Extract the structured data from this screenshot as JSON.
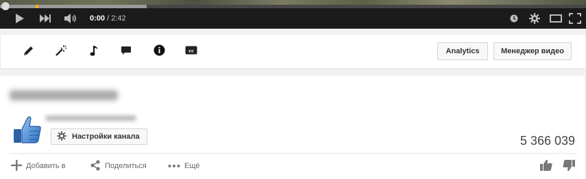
{
  "player": {
    "time_current": "0:00",
    "time_total": "/ 2:42",
    "progress_played_fraction": 0.0,
    "progress_buffered_fraction": 0.25,
    "colors": {
      "background": "#1b1b1b",
      "marker": "#f2b705",
      "buffer": "#9a9a9a"
    },
    "icons": [
      "play-icon",
      "next-icon",
      "volume-icon",
      "watch-later-icon",
      "settings-icon",
      "theater-mode-icon",
      "fullscreen-icon"
    ]
  },
  "toolbar": {
    "icons": [
      "pencil-icon",
      "magic-wand-icon",
      "music-note-icon",
      "annotation-icon",
      "info-icon",
      "captions-icon"
    ],
    "analytics_label": "Analytics",
    "video_manager_label": "Менеджер видео"
  },
  "info": {
    "channel_settings_label": "Настройки канала",
    "view_count": "5 366 039",
    "add_to_label": "Добавить в",
    "share_label": "Поделиться",
    "more_label": "Ещё",
    "icons": [
      "thumbs-up-avatar-icon",
      "gear-icon",
      "plus-icon",
      "share-icon",
      "more-dots-icon",
      "like-icon",
      "dislike-icon"
    ],
    "colors": {
      "avatar_blue": "#3b7bd4"
    }
  }
}
